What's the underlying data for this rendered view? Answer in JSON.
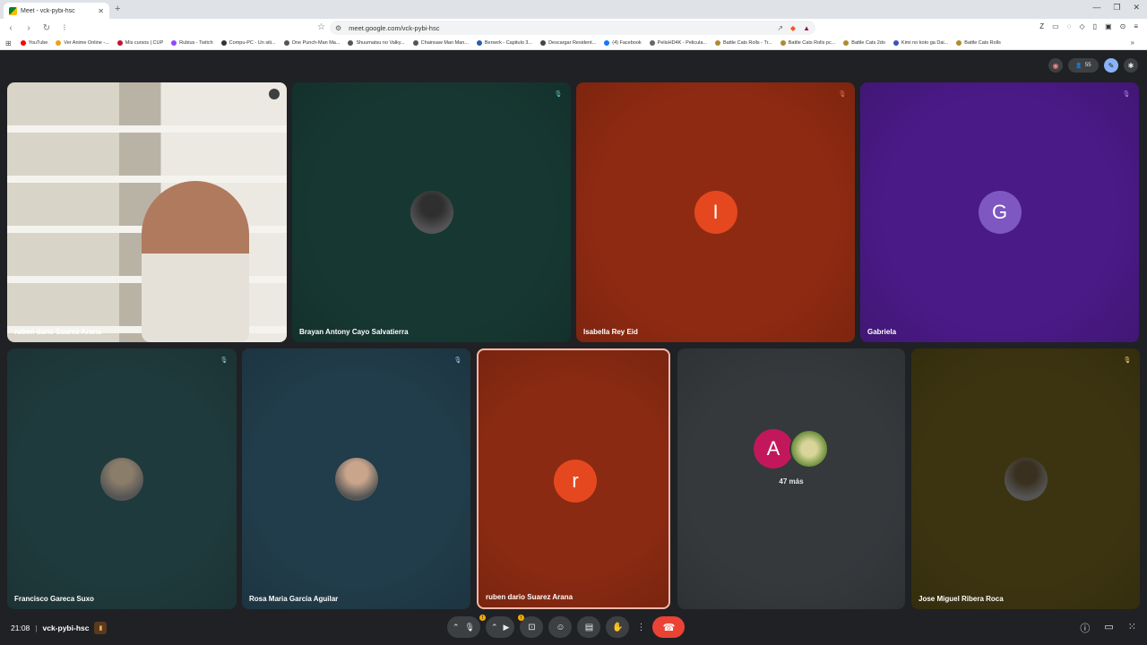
{
  "browser": {
    "tab_title": "Meet - vck-pybi-hsc",
    "new_tab": "+",
    "url": "meet.google.com/vck-pybi-hsc",
    "bookmarks": [
      {
        "label": "YouTube",
        "color": "#ff0000"
      },
      {
        "label": "Ver Anime Online -...",
        "color": "#e8a317"
      },
      {
        "label": "Mis cursos | CUP",
        "color": "#c4122f"
      },
      {
        "label": "Rubius - Twitch",
        "color": "#9146ff"
      },
      {
        "label": "Compu-PC - Un siti...",
        "color": "#333333"
      },
      {
        "label": "One Punch-Man Ma...",
        "color": "#555555"
      },
      {
        "label": "Shuumatsu no Valky...",
        "color": "#555555"
      },
      {
        "label": "Chainsaw Man Man...",
        "color": "#555555"
      },
      {
        "label": "Berserk - Capitulo 3...",
        "color": "#2a5db0"
      },
      {
        "label": "Descargar Resident...",
        "color": "#444444"
      },
      {
        "label": "(4) Facebook",
        "color": "#1877f2"
      },
      {
        "label": "PelisHD4K - Pelicula...",
        "color": "#666666"
      },
      {
        "label": "Battle Cats Rolls - Tr...",
        "color": "#b08a2e"
      },
      {
        "label": "Battle Cats Rolls pc...",
        "color": "#b08a2e"
      },
      {
        "label": "Battle Cats 2do",
        "color": "#b08a2e"
      },
      {
        "label": "Kimi no koto ga Dai...",
        "color": "#3f51b5"
      },
      {
        "label": "Battle Cats Rolls",
        "color": "#b08a2e"
      }
    ]
  },
  "meet": {
    "participant_count": "55",
    "tiles": [
      {
        "name": "ruben dario Suarez Arana",
        "bg": "#7a7466",
        "mic_color": "#3c4043",
        "kind": "video"
      },
      {
        "name": "Brayan Antony Cayo Salvatierra",
        "bg": "#173832",
        "mic_color": "#4ecdc4",
        "kind": "photo",
        "photo": "#2f2f2f"
      },
      {
        "name": "Isabella Rey Eid",
        "bg": "#8f2a12",
        "mic_color": "#ff7043",
        "kind": "letter",
        "letter": "I",
        "avatar_color": "#e5481f"
      },
      {
        "name": "Gabriela",
        "bg": "#4a1a86",
        "mic_color": "#b388ff",
        "kind": "letter",
        "letter": "G",
        "avatar_color": "#7e57c2"
      },
      {
        "name": "Francisco Gareca Suxo",
        "bg": "#1f3a3c",
        "mic_color": "#80cbc4",
        "kind": "photo",
        "photo": "#8a7d6a"
      },
      {
        "name": "Rosa Maria Garcia Aguilar",
        "bg": "#213c4a",
        "mic_color": "#90caf9",
        "kind": "photo",
        "photo": "#c9a58c"
      },
      {
        "name": "ruben dario Suarez Arana",
        "bg": "#8a2a12",
        "mic_color": "",
        "kind": "letter",
        "letter": "r",
        "avatar_color": "#e5481f"
      },
      {
        "name": "",
        "bg": "#35393c",
        "mic_color": "",
        "kind": "group",
        "letter": "A",
        "avatar_color": "#c2185b",
        "more": "47 más"
      },
      {
        "name": "Jose Miguel Ribera Roca",
        "bg": "#3c3410",
        "mic_color": "#fdd663",
        "kind": "photo",
        "photo": "#3a3020"
      }
    ]
  },
  "bottom": {
    "time": "21:08",
    "separator": "|",
    "meeting_code": "vck-pybi-hsc"
  },
  "icons": {
    "mic_off": "mic-off-icon",
    "camera": "videocam-icon",
    "present": "present-icon",
    "emoji": "emoji-icon",
    "captions": "captions-icon",
    "hand": "raise-hand-icon",
    "more": "more-vert-icon",
    "end": "call-end-icon"
  }
}
